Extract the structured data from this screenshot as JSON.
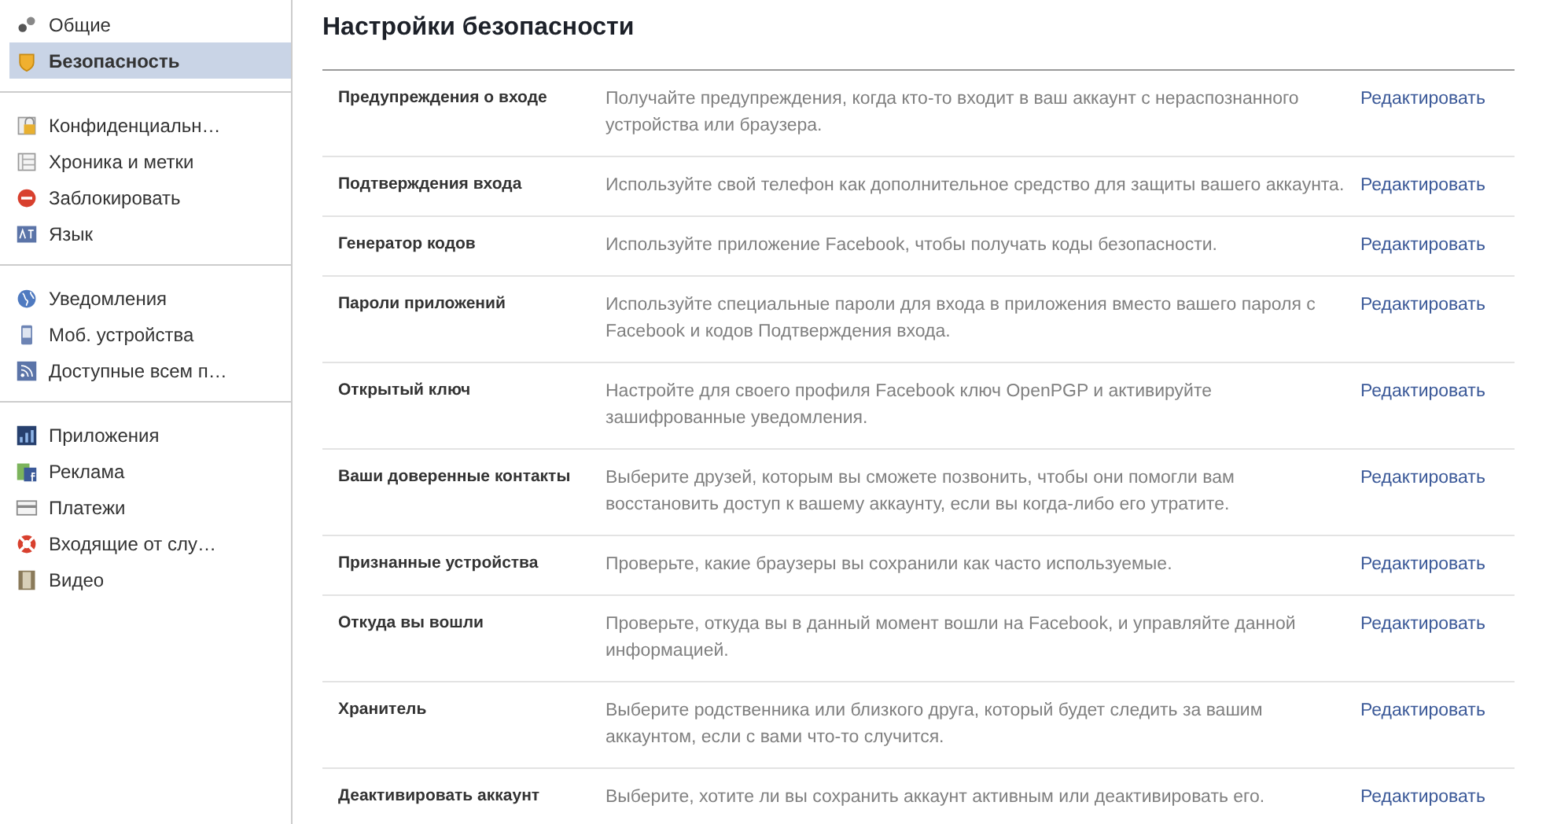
{
  "sidebar": {
    "groups": [
      {
        "items": [
          {
            "label": "Общие",
            "selected": false
          },
          {
            "label": "Безопасность",
            "selected": true
          }
        ]
      },
      {
        "items": [
          {
            "label": "Конфиденциальн…",
            "selected": false
          },
          {
            "label": "Хроника и метки",
            "selected": false
          },
          {
            "label": "Заблокировать",
            "selected": false
          },
          {
            "label": "Язык",
            "selected": false
          }
        ]
      },
      {
        "items": [
          {
            "label": "Уведомления",
            "selected": false
          },
          {
            "label": "Моб. устройства",
            "selected": false
          },
          {
            "label": "Доступные всем п…",
            "selected": false
          }
        ]
      },
      {
        "items": [
          {
            "label": "Приложения",
            "selected": false
          },
          {
            "label": "Реклама",
            "selected": false
          },
          {
            "label": "Платежи",
            "selected": false
          },
          {
            "label": "Входящие от слу…",
            "selected": false
          },
          {
            "label": "Видео",
            "selected": false
          }
        ]
      }
    ]
  },
  "title": "Настройки безопасности",
  "settings": [
    {
      "name": "Предупреждения о входе",
      "description": "Получайте предупреждения, когда кто-то входит в ваш аккаунт с нераспознанного устройства или браузера.",
      "action": "Редактировать"
    },
    {
      "name": "Подтверждения входа",
      "description": "Используйте свой телефон как дополнительное средство для защиты вашего аккаунта.",
      "action": "Редактировать"
    },
    {
      "name": "Генератор кодов",
      "description": "Используйте приложение Facebook, чтобы получать коды безопасности.",
      "action": "Редактировать"
    },
    {
      "name": "Пароли приложений",
      "description": "Используйте специальные пароли для входа в приложения вместо вашего пароля с Facebook и кодов Подтверждения входа.",
      "action": "Редактировать"
    },
    {
      "name": "Открытый ключ",
      "description": "Настройте для своего профиля Facebook ключ OpenPGP и активируйте зашифрованные уведомления.",
      "action": "Редактировать"
    },
    {
      "name": "Ваши доверенные контакты",
      "description": "Выберите друзей, которым вы сможете позвонить, чтобы они помогли вам восстановить доступ к вашему аккаунту, если вы когда-либо его утратите.",
      "action": "Редактировать"
    },
    {
      "name": "Признанные устройства",
      "description": "Проверьте, какие браузеры вы сохранили как часто используемые.",
      "action": "Редактировать"
    },
    {
      "name": "Откуда вы вошли",
      "description": "Проверьте, откуда вы в данный момент вошли на Facebook, и управляйте данной информацией.",
      "action": "Редактировать"
    },
    {
      "name": "Хранитель",
      "description": "Выберите родственника или близкого друга, который будет следить за вашим аккаунтом, если с вами что-то случится.",
      "action": "Редактировать"
    },
    {
      "name": "Деактивировать аккаунт",
      "description": "Выберите, хотите ли вы сохранить аккаунт активным или деактивировать его.",
      "action": "Редактировать"
    }
  ]
}
